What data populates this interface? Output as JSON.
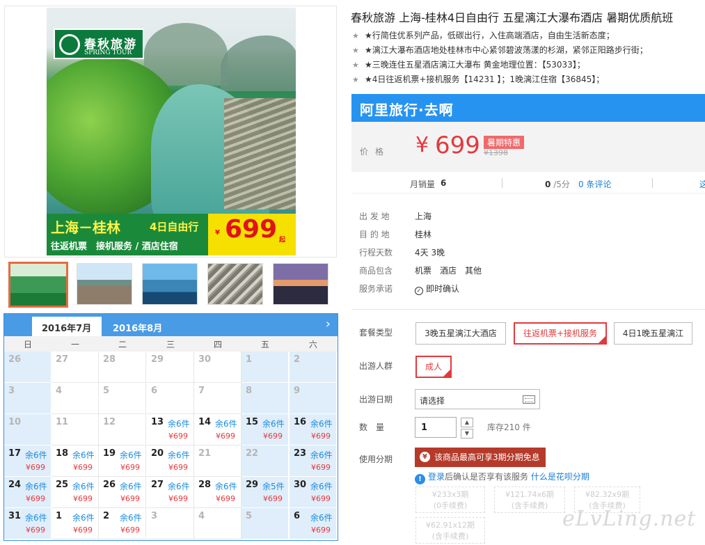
{
  "product": {
    "title": "春秋旅游 上海-桂林4日自由行 五星漓江大瀑布酒店 暑期优质航班",
    "bullets": [
      "★行简住优系列产品，低碳出行，入住高端酒店，自由生活新态度；",
      "★漓江大瀑布酒店地处桂林市中心紧邻碧波荡漾的杉湖，紧邻正阳路步行街；",
      "★三晚连住五星酒店漓江大瀑布 黄金地理位置：【53033】；",
      "★4日往返机票+接机服务【14231 】；1晚漓江住宿【36845】；"
    ]
  },
  "banner": {
    "logo_cn": "春秋旅游",
    "logo_en": "SPRING TOUR",
    "route": "上海－桂林",
    "days": "4日自由行",
    "services": "往返机票　接机服务 / 酒店住宿",
    "yen": "¥",
    "price": "699",
    "qi": "起"
  },
  "brand": {
    "name": "阿里旅行·去啊"
  },
  "pricing": {
    "label": "价格",
    "currency": "¥",
    "price": "699",
    "badge": "暑期特惠",
    "original": "¥1398"
  },
  "stats": {
    "sold_label": "月销量",
    "sold_value": "6",
    "score": "0",
    "score_max": "/5分",
    "reviews": "0 条评论",
    "cut_off": "这"
  },
  "info": [
    {
      "key": "出 发 地",
      "value": "上海"
    },
    {
      "key": "目 的 地",
      "value": "桂林"
    },
    {
      "key": "行程天数",
      "value": "4天 3晚"
    },
    {
      "key": "商品包含",
      "value": "机票　酒店　其他"
    },
    {
      "key": "服务承诺",
      "value": "即时确认"
    }
  ],
  "options": {
    "package_label": "套餐类型",
    "packages": [
      "3晚五星漓江大酒店",
      "往返机票+接机服务",
      "4日1晚五星漓江"
    ],
    "crowd_label": "出游人群",
    "crowd": "成人",
    "date_label": "出游日期",
    "date_placeholder": "请选择",
    "qty_label": "数　量",
    "qty_value": "1",
    "stock": "库存210 件",
    "install_label": "使用分期",
    "install_button": "该商品最高可享3期分期免息",
    "login_link": "登录",
    "login_text": "后确认是否享有该服务",
    "what_link": "什么是花呗分期",
    "plans": [
      {
        "l1": "¥233x3期",
        "l2": "(0手续费)"
      },
      {
        "l1": "¥121.74x6期",
        "l2": "(含手续费)"
      },
      {
        "l1": "¥82.32x9期",
        "l2": "(含手续费)"
      },
      {
        "l1": "¥62.91x12期",
        "l2": "(含手续费)"
      }
    ]
  },
  "calendar": {
    "tabs": [
      "2016年7月",
      "2016年8月"
    ],
    "next": "›",
    "weekdays": [
      "日",
      "一",
      "二",
      "三",
      "四",
      "五",
      "六"
    ],
    "weeks": [
      [
        {
          "d": "26",
          "m": true
        },
        {
          "d": "27",
          "m": true
        },
        {
          "d": "28",
          "m": true
        },
        {
          "d": "29",
          "m": true
        },
        {
          "d": "30",
          "m": true
        },
        {
          "d": "1",
          "m": true
        },
        {
          "d": "2",
          "m": true
        }
      ],
      [
        {
          "d": "3",
          "m": true
        },
        {
          "d": "4",
          "m": true
        },
        {
          "d": "5",
          "m": true
        },
        {
          "d": "6",
          "m": true
        },
        {
          "d": "7",
          "m": true
        },
        {
          "d": "8",
          "m": true
        },
        {
          "d": "9",
          "m": true
        }
      ],
      [
        {
          "d": "10",
          "m": true
        },
        {
          "d": "11",
          "m": true
        },
        {
          "d": "12",
          "m": true
        },
        {
          "d": "13",
          "s": "余6件",
          "p": "¥699"
        },
        {
          "d": "14",
          "s": "余6件",
          "p": "¥699"
        },
        {
          "d": "15",
          "s": "余6件",
          "p": "¥699"
        },
        {
          "d": "16",
          "s": "余6件",
          "p": "¥699"
        }
      ],
      [
        {
          "d": "17",
          "s": "余6件",
          "p": "¥699"
        },
        {
          "d": "18",
          "s": "余6件",
          "p": "¥699"
        },
        {
          "d": "19",
          "s": "余6件",
          "p": "¥699"
        },
        {
          "d": "20",
          "s": "余6件",
          "p": "¥699"
        },
        {
          "d": "21",
          "m": true
        },
        {
          "d": "22",
          "m": true
        },
        {
          "d": "23",
          "s": "余6件",
          "p": "¥699"
        }
      ],
      [
        {
          "d": "24",
          "s": "余6件",
          "p": "¥699"
        },
        {
          "d": "25",
          "s": "余6件",
          "p": "¥699"
        },
        {
          "d": "26",
          "s": "余6件",
          "p": "¥699"
        },
        {
          "d": "27",
          "s": "余6件",
          "p": "¥699"
        },
        {
          "d": "28",
          "s": "余6件",
          "p": "¥699"
        },
        {
          "d": "29",
          "s": "余5件",
          "p": "¥699"
        },
        {
          "d": "30",
          "s": "余6件",
          "p": "¥699"
        }
      ],
      [
        {
          "d": "31",
          "s": "余6件",
          "p": "¥699"
        },
        {
          "d": "1",
          "s": "余6件",
          "p": "¥699"
        },
        {
          "d": "2",
          "s": "余6件",
          "p": "¥699"
        },
        {
          "d": "3",
          "m": true
        },
        {
          "d": "4",
          "m": true
        },
        {
          "d": "5",
          "m": true
        },
        {
          "d": "6",
          "s": "余6件",
          "p": "¥699"
        }
      ]
    ]
  },
  "watermark": "eLvLing.net"
}
